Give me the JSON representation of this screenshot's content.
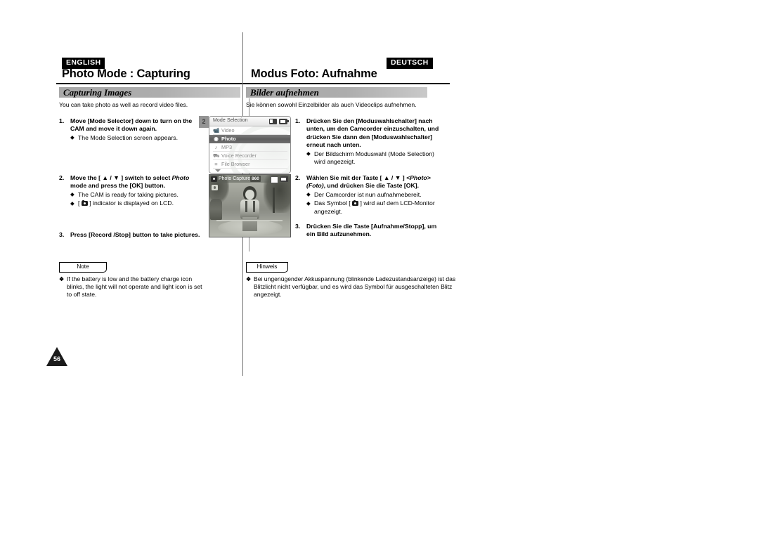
{
  "left_page": {
    "language_tag": "ENGLISH",
    "title": "Photo Mode : Capturing",
    "section_heading": "Capturing Images",
    "intro": "You can take photo as well as record video files.",
    "steps": [
      {
        "num": "1.",
        "lead": "Move [Mode Selector] down to turn on the CAM and move it down again.",
        "bullets": [
          "The Mode Selection screen appears."
        ]
      },
      {
        "num": "2.",
        "lead_pre": "Move the [ ▲ / ▼ ] switch to select ",
        "lead_italic": "Photo",
        "lead_post": " mode and press the [OK] button.",
        "bullets": [
          "The CAM is ready for taking pictures."
        ],
        "bullet_icon_text_pre": "[ ",
        "bullet_icon_text_post": " ] indicator is displayed on LCD."
      },
      {
        "num": "3.",
        "lead": "Press [Record /Stop] button to take pictures.",
        "bullets": []
      }
    ],
    "note_label": "Note",
    "note_marker": "❖",
    "note_text": "If the battery is low and the battery charge icon blinks, the light will not operate and light icon is set to off state."
  },
  "right_page": {
    "language_tag": "DEUTSCH",
    "title": "Modus Foto: Aufnahme",
    "section_heading": "Bilder aufnehmen",
    "intro": "Sie können sowohl Einzelbilder als auch Videoclips aufnehmen.",
    "steps": [
      {
        "num": "1.",
        "lead": "Drücken Sie den [Moduswahlschalter] nach unten, um den Camcorder einzuschalten, und drücken Sie dann den [Moduswahlschalter] erneut nach unten.",
        "bullets": [
          "Der Bildschirm Moduswahl (Mode Selection) wird angezeigt."
        ]
      },
      {
        "num": "2.",
        "lead_pre": "Wählen Sie mit der Taste [ ▲ / ▼ ] ",
        "lead_italic": "<Photo> (Foto)",
        "lead_post": ", und drücken Sie die Taste [OK].",
        "bullets": [
          "Der Camcorder ist nun aufnahmebereit."
        ],
        "bullet_icon_text_pre": "Das Symbol [ ",
        "bullet_icon_text_post": " ] wird auf dem LCD-Monitor angezeigt."
      },
      {
        "num": "3.",
        "lead": "Drücken Sie die Taste [Aufnahme/Stopp], um ein Bild aufzunehmen.",
        "bullets": []
      }
    ],
    "note_label": "Hinweis",
    "note_marker": "❖",
    "note_text": "Bei ungenügender Akkuspannung (blinkende Ladezustandsanzeige) ist das Blitzlicht nicht verfügbar, und es wird das Symbol für ausgeschalteten Blitz angezeigt."
  },
  "figures": {
    "step_marker": "2",
    "mode_selection_screen": {
      "title": "Mode Selection",
      "status_icons": [
        "memory-card-icon",
        "battery-icon"
      ],
      "items": [
        {
          "label": "Video",
          "icon": "🎥",
          "selected": false
        },
        {
          "label": "Photo",
          "icon": "◉",
          "selected": true
        },
        {
          "label": "MP3",
          "icon": "♪",
          "selected": false
        },
        {
          "label": "Voice Recorder",
          "icon": "♀",
          "selected": false
        },
        {
          "label": "File Browser",
          "icon": "≡",
          "selected": false
        }
      ],
      "scroll_down_indicator": "scroll-down-arrow-icon"
    },
    "photo_capture_screen": {
      "title": "Photo Capture",
      "counter": "860",
      "mode_icon": "photo-mode-icon",
      "status_icons": [
        "memory-card-icon",
        "battery-icon"
      ]
    }
  },
  "page_number": "56",
  "colors": {
    "text": "#000000",
    "section_bar": "#a8a8a8",
    "divider": "#6e6e6e",
    "tag_background": "#000000",
    "tag_text": "#ffffff"
  }
}
